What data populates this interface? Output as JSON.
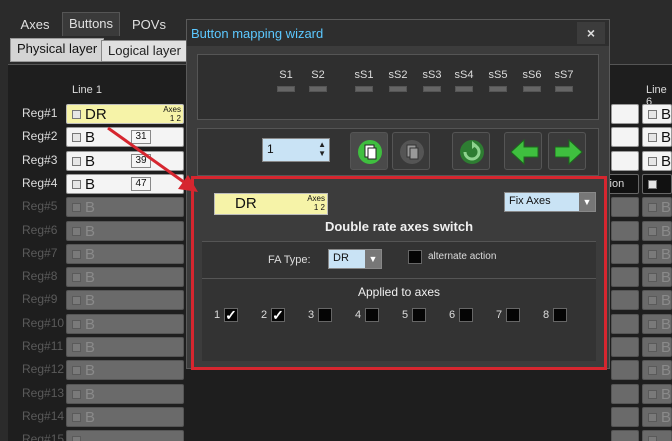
{
  "tabs": [
    {
      "label": "Axes",
      "active": false
    },
    {
      "label": "Buttons",
      "active": true
    },
    {
      "label": "POVs",
      "active": false
    }
  ],
  "subtabs": [
    {
      "label": "Physical layer",
      "active": true
    },
    {
      "label": "Logical layer",
      "active": false
    }
  ],
  "grid": {
    "col_headers": [
      "Line 1",
      "Line 6"
    ],
    "rows": [
      {
        "reg": "Reg#1",
        "text": "DR",
        "num": "",
        "enabled": true,
        "axes_label": "Axes",
        "axes_nums": "1 2",
        "right_text": "B"
      },
      {
        "reg": "Reg#2",
        "text": "B",
        "num": "31",
        "enabled": true,
        "right_text": "B"
      },
      {
        "reg": "Reg#3",
        "text": "B",
        "num": "39",
        "enabled": true,
        "right_text": "B"
      },
      {
        "reg": "Reg#4",
        "text": "B",
        "num": "47",
        "enabled": true,
        "partial_text": "ction",
        "right_text": ""
      },
      {
        "reg": "Reg#5",
        "text": "B",
        "enabled": false,
        "right_text": "B"
      },
      {
        "reg": "Reg#6",
        "text": "B",
        "enabled": false,
        "right_text": "B"
      },
      {
        "reg": "Reg#7",
        "text": "B",
        "enabled": false,
        "right_text": "B"
      },
      {
        "reg": "Reg#8",
        "text": "B",
        "enabled": false,
        "right_text": "B"
      },
      {
        "reg": "Reg#9",
        "text": "B",
        "enabled": false,
        "right_text": "B"
      },
      {
        "reg": "Reg#10",
        "text": "B",
        "enabled": false,
        "right_text": "B"
      },
      {
        "reg": "Reg#11",
        "text": "B",
        "enabled": false,
        "right_text": "B"
      },
      {
        "reg": "Reg#12",
        "text": "B",
        "enabled": false,
        "right_text": "B"
      },
      {
        "reg": "Reg#13",
        "text": "B",
        "enabled": false,
        "right_text": "B"
      },
      {
        "reg": "Reg#14",
        "text": "B",
        "enabled": false,
        "right_text": "B"
      },
      {
        "reg": "Reg#15",
        "text": "",
        "enabled": false,
        "right_text": ""
      }
    ]
  },
  "dialog": {
    "title": "Button mapping wizard",
    "close_glyph": "×",
    "shifts": [
      "S1",
      "S2",
      "sS1",
      "sS2",
      "sS3",
      "sS4",
      "sS5",
      "sS6",
      "sS7"
    ],
    "spin_value": "1",
    "mapping": {
      "cell_text": "DR",
      "axes_label": "Axes",
      "axes_nums": "1 2",
      "mode_select": "Fix Axes",
      "title": "Double rate axes switch",
      "fa_type_label": "FA Type:",
      "fa_type_value": "DR",
      "alternate_action_label": "alternate action",
      "applied_label": "Applied to axes",
      "axes": [
        {
          "n": "1",
          "checked": true
        },
        {
          "n": "2",
          "checked": true
        },
        {
          "n": "3",
          "checked": false
        },
        {
          "n": "4",
          "checked": false
        },
        {
          "n": "5",
          "checked": false
        },
        {
          "n": "6",
          "checked": false
        },
        {
          "n": "7",
          "checked": false
        },
        {
          "n": "8",
          "checked": false
        }
      ]
    },
    "check_glyph": "✓"
  },
  "colors": {
    "highlight_red": "#d6262f",
    "title_blue": "#5cc8ff",
    "select_blue": "#c9e3f5",
    "cell_yellow": "#f6f3a8",
    "button_green": "#3fbf3f"
  }
}
